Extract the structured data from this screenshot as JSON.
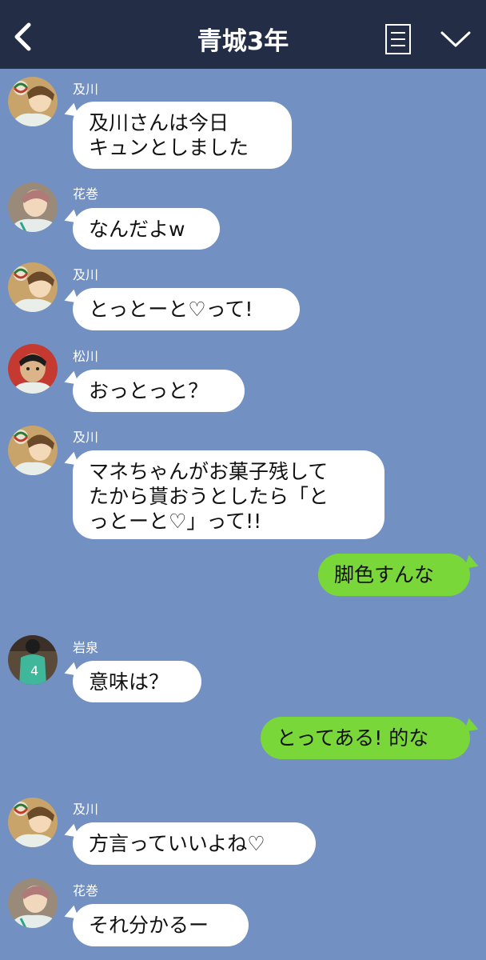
{
  "header": {
    "title": "青城3年"
  },
  "messages": [
    {
      "sender": "及川",
      "text": "及川さんは今日\nキュンとしました"
    },
    {
      "sender": "花巻",
      "text": "なんだよw"
    },
    {
      "sender": "及川",
      "text": "とっとーと♡って!"
    },
    {
      "sender": "松川",
      "text": "おっとっと？"
    },
    {
      "sender": "及川",
      "text": "マネちゃんがお菓子残して\nたから貰おうとしたら「と\nっとーと♡」って!!"
    },
    {
      "sender": "",
      "text": "脚色すんな",
      "outgoing": true
    },
    {
      "sender": "岩泉",
      "text": "意味は？"
    },
    {
      "sender": "",
      "text": "とってある! 的な",
      "outgoing": true
    },
    {
      "sender": "及川",
      "text": "方言っていいよね♡"
    },
    {
      "sender": "花巻",
      "text": "それ分かるー"
    }
  ],
  "colors": {
    "header_bg": "#232d45",
    "chat_bg": "#7290c1",
    "outgoing_bubble": "#7ad73a",
    "incoming_bubble": "#ffffff"
  }
}
